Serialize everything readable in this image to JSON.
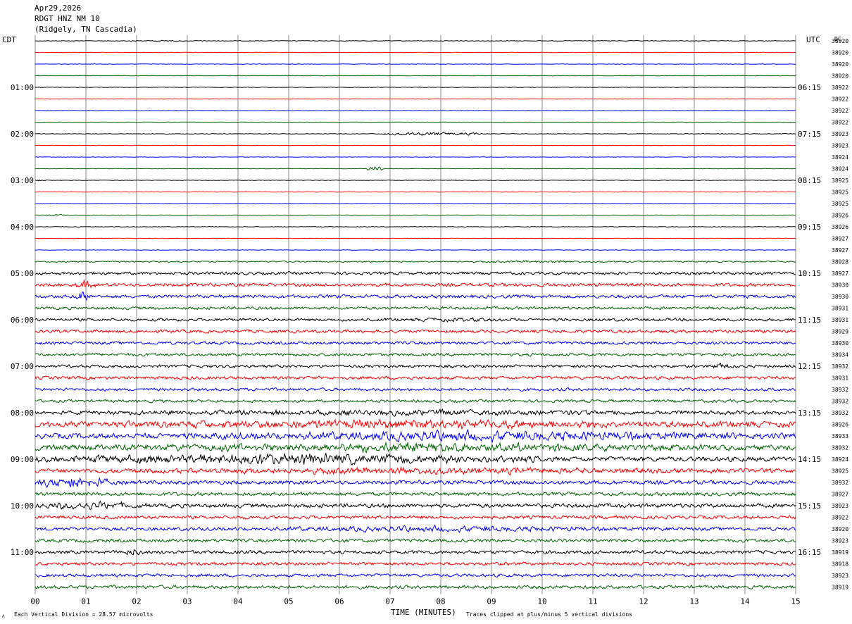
{
  "header": {
    "date": "Apr29,2026",
    "station": "RDGT HNZ NM 10",
    "location": "(Ridgely, TN Cascadia)"
  },
  "chart_data": {
    "type": "line",
    "title": "",
    "xlabel": "TIME (MINUTES)",
    "left_axis_label": "CDT",
    "right_axis_label": "UTC",
    "dc_label": "DC",
    "xlim": [
      0,
      15
    ],
    "x_ticks": [
      "00",
      "01",
      "02",
      "03",
      "04",
      "05",
      "06",
      "07",
      "08",
      "09",
      "10",
      "11",
      "12",
      "13",
      "14",
      "15"
    ],
    "left_time_labels": [
      "01:00",
      "02:00",
      "03:00",
      "04:00",
      "05:00",
      "06:00",
      "07:00",
      "08:00",
      "09:00",
      "10:00",
      "11:00"
    ],
    "right_time_labels": [
      "06:15",
      "07:15",
      "08:15",
      "09:15",
      "10:15",
      "11:15",
      "12:15",
      "13:15",
      "14:15",
      "15:15",
      "16:15"
    ],
    "dc_values": [
      38920,
      38920,
      38920,
      38920,
      38922,
      38922,
      38922,
      38922,
      38923,
      38923,
      38924,
      38924,
      38925,
      38925,
      38925,
      38926,
      38926,
      38927,
      38927,
      38928,
      38927,
      38930,
      38930,
      38931,
      38931,
      38929,
      38930,
      38934,
      38932,
      38931,
      38932,
      38932,
      38932,
      38926,
      38933,
      38932,
      38924,
      38925,
      38932,
      38927,
      38923,
      38922,
      38920,
      38923,
      38919,
      38918,
      38923,
      38919
    ],
    "trace_colors": [
      "#000000",
      "#ff0000",
      "#0000ff",
      "#006400"
    ],
    "grid": true,
    "series": [
      {
        "noise": [
          0.5,
          0.4,
          0.4,
          0.4,
          0.5,
          0.4,
          0.4,
          0.4,
          0.5,
          0.4,
          0.4,
          0.4,
          0.5,
          0.4,
          0.4,
          0.4,
          0.5,
          0.4,
          0.4,
          1.3,
          2.6,
          3.0,
          3.0,
          2.6,
          2.6,
          2.8,
          2.6,
          2.6,
          2.6,
          2.8,
          2.6,
          2.6,
          3.2,
          4.8,
          4.8,
          4.2,
          4.2,
          3.6,
          3.6,
          3.2,
          3.6,
          3.0,
          3.0,
          3.0,
          3.0,
          2.8,
          2.8,
          3.0
        ]
      }
    ],
    "events": [
      {
        "trace": 0,
        "start": 1.8,
        "end": 3.0,
        "amp": 1.4
      },
      {
        "trace": 8,
        "start": 6.8,
        "end": 8.8,
        "amp": 4.0
      },
      {
        "trace": 11,
        "start": 6.55,
        "end": 6.85,
        "amp": 6.0
      },
      {
        "trace": 12,
        "start": 0.0,
        "end": 0.25,
        "amp": 2.5
      },
      {
        "trace": 15,
        "start": 0.2,
        "end": 0.6,
        "amp": 2.0
      },
      {
        "trace": 19,
        "start": 8.5,
        "end": 11.5,
        "amp": 3.0
      },
      {
        "trace": 21,
        "start": 0.8,
        "end": 1.2,
        "amp": 10.0
      },
      {
        "trace": 22,
        "start": 0.8,
        "end": 1.1,
        "amp": 14.0
      },
      {
        "trace": 24,
        "start": 6.3,
        "end": 10.5,
        "amp": 4.5
      },
      {
        "trace": 28,
        "start": 13.3,
        "end": 13.8,
        "amp": 8.0
      },
      {
        "trace": 32,
        "start": 0.0,
        "end": 15.0,
        "amp": 7.0
      },
      {
        "trace": 33,
        "start": 0.0,
        "end": 15.0,
        "amp": 11.0
      },
      {
        "trace": 34,
        "start": 2.2,
        "end": 15.0,
        "amp": 12.0
      },
      {
        "trace": 35,
        "start": 0.0,
        "end": 15.0,
        "amp": 11.0
      },
      {
        "trace": 36,
        "start": 0.0,
        "end": 10.0,
        "amp": 13.0
      },
      {
        "trace": 37,
        "start": 0.0,
        "end": 15.0,
        "amp": 8.0
      },
      {
        "trace": 38,
        "start": 0.0,
        "end": 1.5,
        "amp": 14.0
      },
      {
        "trace": 40,
        "start": 0.0,
        "end": 2.2,
        "amp": 10.0
      },
      {
        "trace": 42,
        "start": 3.2,
        "end": 12.8,
        "amp": 7.0
      },
      {
        "trace": 44,
        "start": 1.7,
        "end": 2.2,
        "amp": 9.0
      }
    ]
  },
  "footer": {
    "scale_note": "Each Vertical Division =   28.57 microvolts",
    "clip_note": "Traces clipped at plus/minus 5 vertical divisions"
  }
}
